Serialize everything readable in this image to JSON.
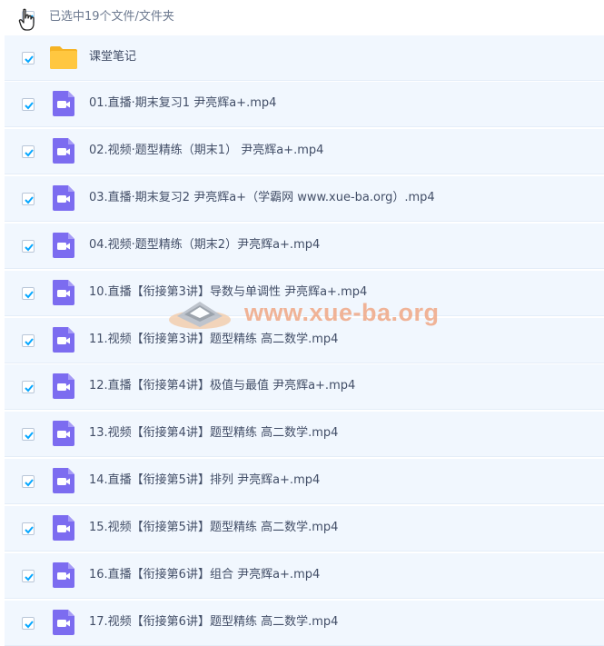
{
  "header": {
    "selection_text": "已选中19个文件/文件夹"
  },
  "files": [
    {
      "name": "课堂笔记",
      "type": "folder",
      "icon": "folder-icon"
    },
    {
      "name": "01.直播·期末复习1 尹亮辉a+.mp4",
      "type": "video",
      "icon": "video-file-icon"
    },
    {
      "name": "02.视频·题型精练（期末1） 尹亮辉a+.mp4",
      "type": "video",
      "icon": "video-file-icon"
    },
    {
      "name": "03.直播·期末复习2 尹亮辉a+（学霸网 www.xue-ba.org）.mp4",
      "type": "video",
      "icon": "video-file-icon"
    },
    {
      "name": "04.视频·题型精练（期末2）尹亮辉a+.mp4",
      "type": "video",
      "icon": "video-file-icon"
    },
    {
      "name": "10.直播【衔接第3讲】导数与单调性 尹亮辉a+.mp4",
      "type": "video",
      "icon": "video-file-icon"
    },
    {
      "name": "11.视频【衔接第3讲】题型精练 高二数学.mp4",
      "type": "video",
      "icon": "video-file-icon"
    },
    {
      "name": "12.直播【衔接第4讲】极值与最值 尹亮辉a+.mp4",
      "type": "video",
      "icon": "video-file-icon"
    },
    {
      "name": "13.视频【衔接第4讲】题型精练 高二数学.mp4",
      "type": "video",
      "icon": "video-file-icon"
    },
    {
      "name": "14.直播【衔接第5讲】排列 尹亮辉a+.mp4",
      "type": "video",
      "icon": "video-file-icon"
    },
    {
      "name": "15.视频【衔接第5讲】题型精练 高二数学.mp4",
      "type": "video",
      "icon": "video-file-icon"
    },
    {
      "name": "16.直播【衔接第6讲】组合 尹亮辉a+.mp4",
      "type": "video",
      "icon": "video-file-icon"
    },
    {
      "name": "17.视频【衔接第6讲】题型精练 高二数学.mp4",
      "type": "video",
      "icon": "video-file-icon"
    }
  ],
  "watermark": {
    "text": "www.xue-ba.org"
  },
  "colors": {
    "row_bg": "#f1f7fe",
    "check_accent": "#06a7ff",
    "video_icon": "#7c6cf0",
    "folder_icon": "#ffc740",
    "watermark": "#f0a37e"
  }
}
